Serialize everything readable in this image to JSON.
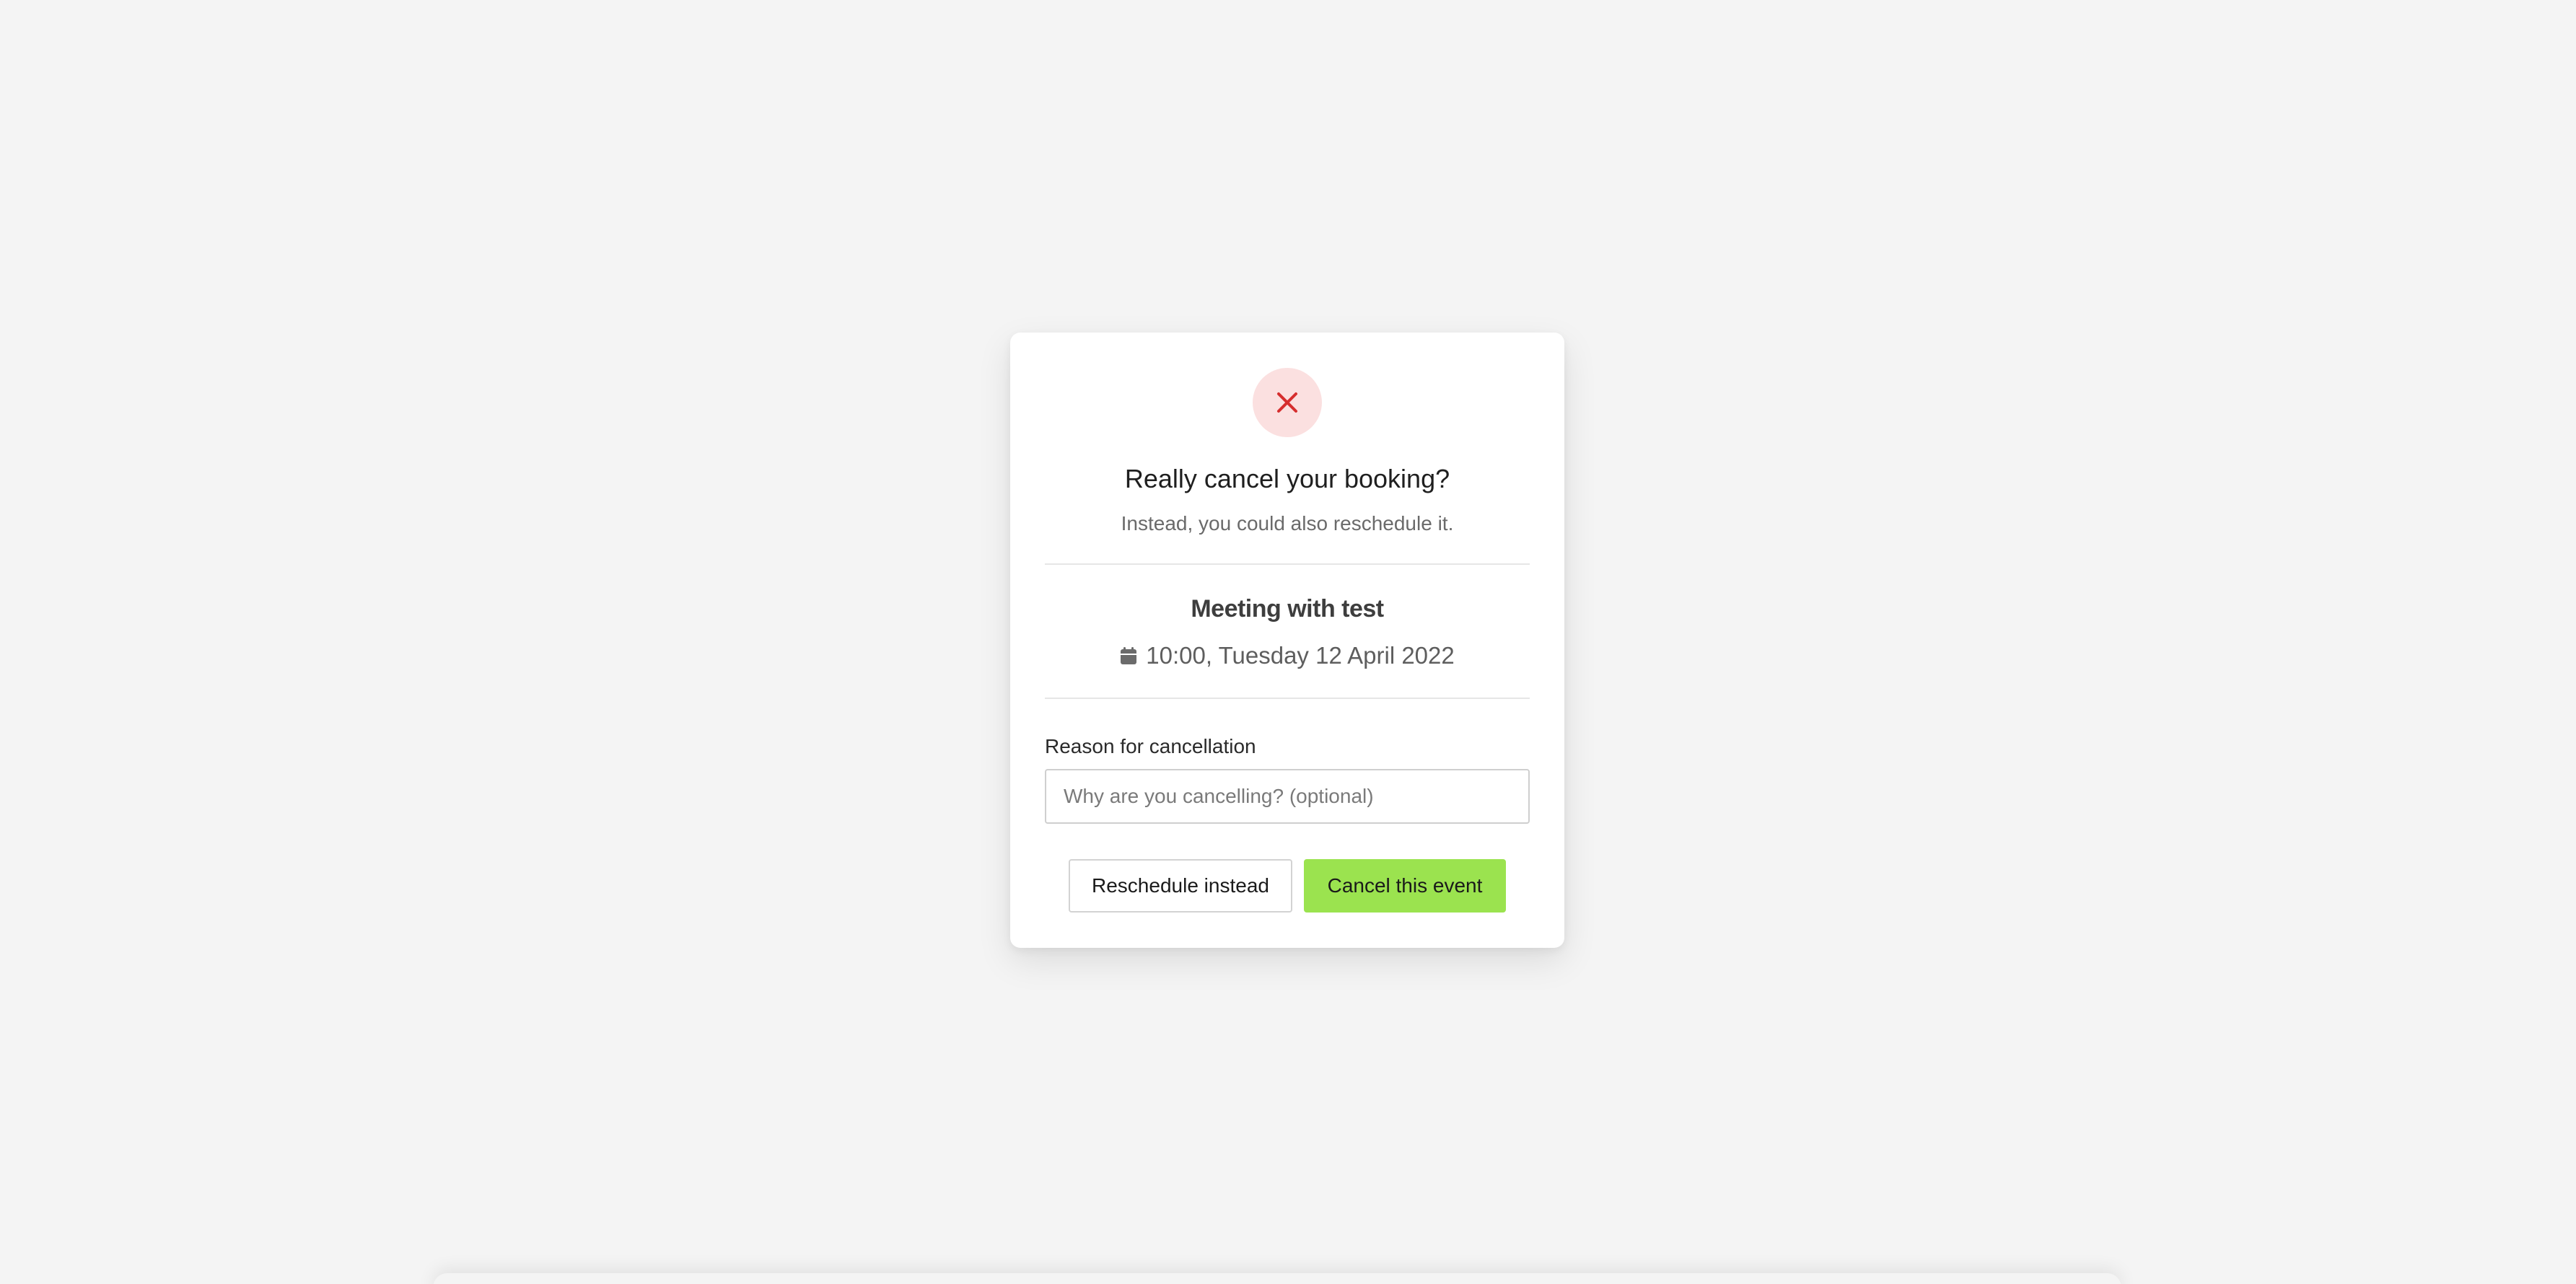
{
  "dialog": {
    "icon": "close-icon",
    "title": "Really cancel your booking?",
    "subtitle": "Instead, you could also reschedule it."
  },
  "event": {
    "title": "Meeting with test",
    "date_icon": "calendar-icon",
    "datetime": "10:00, Tuesday 12 April 2022"
  },
  "form": {
    "reason_label": "Reason for cancellation",
    "reason_value": "",
    "reason_placeholder": "Why are you cancelling? (optional)"
  },
  "actions": {
    "reschedule_label": "Reschedule instead",
    "cancel_label": "Cancel this event"
  },
  "colors": {
    "background": "#f4f4f4",
    "icon_bg": "#fbe0e0",
    "icon_stroke": "#d62e2e",
    "primary_button": "#9be34f"
  }
}
